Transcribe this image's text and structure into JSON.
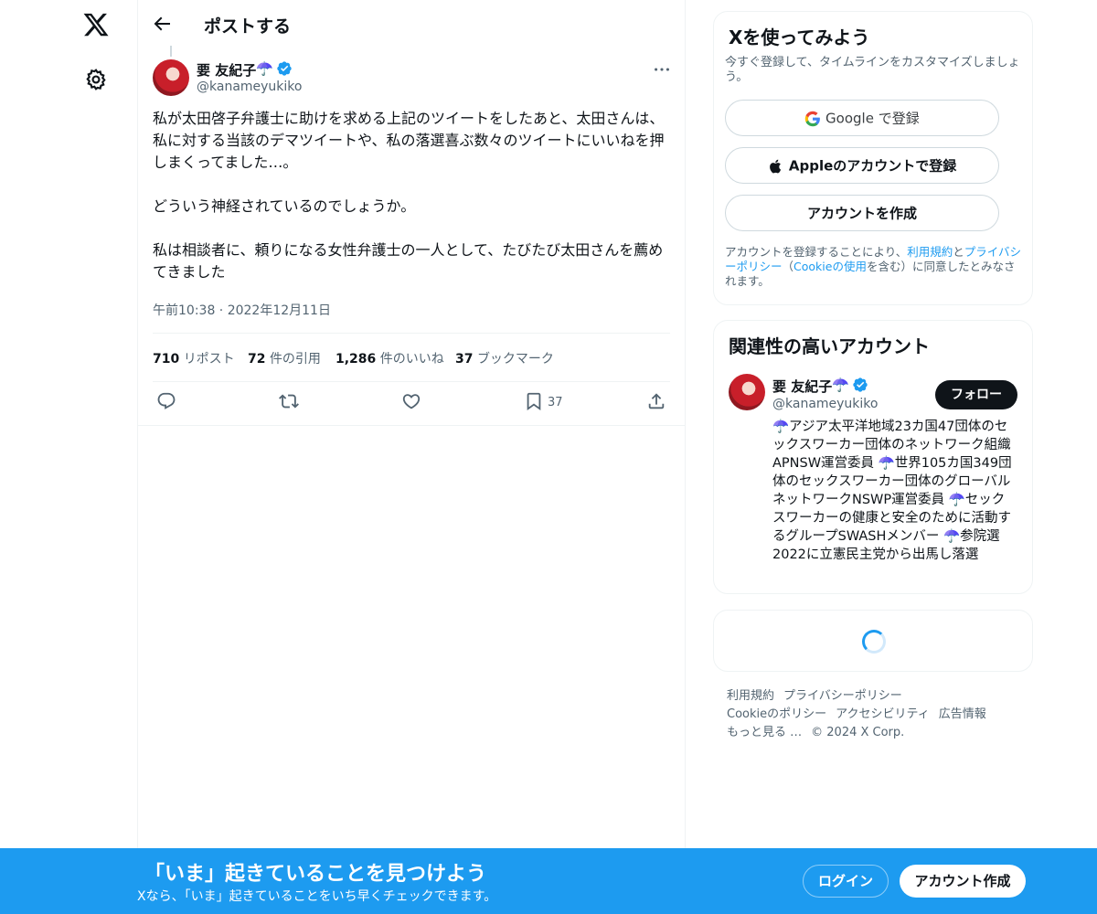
{
  "nav": {
    "logo_icon": "x-logo-icon",
    "settings_icon": "gear-icon"
  },
  "header": {
    "back_icon": "arrow-left-icon",
    "title": "ポストする"
  },
  "post": {
    "author_name": "要 友紀子",
    "author_emoji": "☂️",
    "author_handle": "@kanameyukiko",
    "verified_color": "#1d9bf0",
    "text": "私が太田啓子弁護士に助けを求める上記のツイートをしたあと、太田さんは、私に対する当該のデマツイートや、私の落選喜ぶ数々のツイートにいいねを押しまくってました…。\n\nどういう神経されているのでしょうか。\n\n私は相談者に、頼りになる女性弁護士の一人として、たびたび太田さんを薦めてきました",
    "timestamp": "午前10:38 · 2022年12月11日",
    "stats": {
      "reposts_count": "710",
      "reposts_label": "リポスト",
      "quotes_count": "72",
      "quotes_label": "件の引用",
      "likes_count": "1,286",
      "likes_label": "件のいいね",
      "bookmarks_count": "37",
      "bookmarks_label": "ブックマーク"
    },
    "actions": {
      "bookmark_count": "37"
    }
  },
  "signup": {
    "title": "Xを使ってみよう",
    "subtitle": "今すぐ登録して、タイムラインをカスタマイズしましょう。",
    "google_label": "Google で登録",
    "apple_label": "Appleのアカウントで登録",
    "create_label": "アカウントを作成",
    "legal_pre": "アカウントを登録することにより、",
    "terms_link": "利用規約",
    "legal_and": "と",
    "privacy_link": "プライバシーポリシー",
    "legal_mid": "（",
    "cookie_link": "Cookieの使用",
    "legal_post": "を含む）に同意したとみなされます。"
  },
  "related": {
    "title": "関連性の高いアカウント",
    "name": "要 友紀子",
    "emoji": "☂️",
    "handle": "@kanameyukiko",
    "follow_label": "フォロー",
    "bio": "☂️アジア太平洋地域23カ国47団体のセックスワーカー団体のネットワーク組織APNSW運営委員 ☂️世界105カ国349団体のセックスワーカー団体のグローバルネットワークNSWP運営委員 ☂️セックスワーカーの健康と安全のために活動するグループSWASHメンバー ☂️参院選2022に立憲民主党から出馬し落選"
  },
  "footer": {
    "terms": "利用規約",
    "privacy": "プライバシーポリシー",
    "cookie": "Cookieのポリシー",
    "accessibility": "アクセシビリティ",
    "ads": "広告情報",
    "more": "もっと見る …",
    "copyright": "© 2024 X Corp."
  },
  "banner": {
    "title": "「いま」起きていることを見つけよう",
    "subtitle": "Xなら、「いま」起きていることをいち早くチェックできます。",
    "login_label": "ログイン",
    "create_label": "アカウント作成"
  },
  "colors": {
    "accent": "#1d9bf0",
    "text": "#0f1419",
    "muted": "#536471"
  }
}
